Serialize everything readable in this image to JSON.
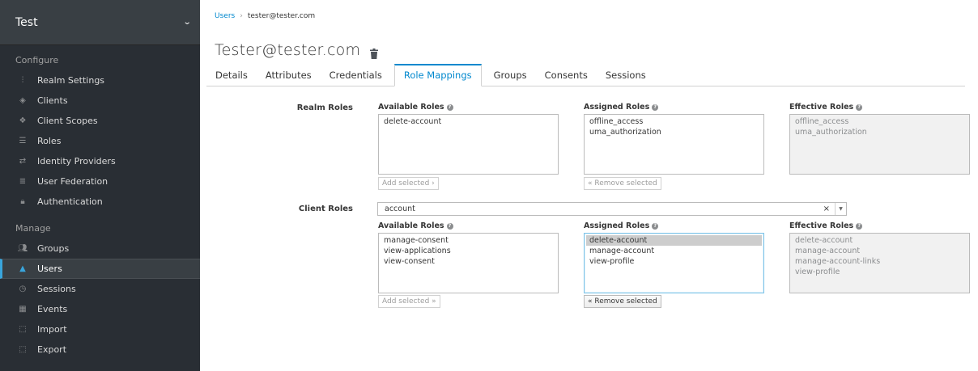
{
  "sidebar": {
    "realm": "Test",
    "configure_label": "Configure",
    "manage_label": "Manage",
    "configure_items": [
      {
        "label": "Realm Settings",
        "icon": "sliders-icon"
      },
      {
        "label": "Clients",
        "icon": "cube-icon"
      },
      {
        "label": "Client Scopes",
        "icon": "cubes-icon"
      },
      {
        "label": "Roles",
        "icon": "list-icon"
      },
      {
        "label": "Identity Providers",
        "icon": "exchange-icon"
      },
      {
        "label": "User Federation",
        "icon": "database-icon"
      },
      {
        "label": "Authentication",
        "icon": "lock-icon"
      }
    ],
    "manage_items": [
      {
        "label": "Groups",
        "icon": "users-icon"
      },
      {
        "label": "Users",
        "icon": "user-icon",
        "active": true
      },
      {
        "label": "Sessions",
        "icon": "clock-icon"
      },
      {
        "label": "Events",
        "icon": "calendar-icon"
      },
      {
        "label": "Import",
        "icon": "import-icon"
      },
      {
        "label": "Export",
        "icon": "export-icon"
      }
    ]
  },
  "breadcrumb": {
    "parent": "Users",
    "current": "tester@tester.com"
  },
  "title": "Tester@tester.com",
  "tabs": [
    "Details",
    "Attributes",
    "Credentials",
    "Role Mappings",
    "Groups",
    "Consents",
    "Sessions"
  ],
  "active_tab": "Role Mappings",
  "realm_roles": {
    "label": "Realm Roles",
    "available_label": "Available Roles",
    "assigned_label": "Assigned Roles",
    "effective_label": "Effective Roles",
    "available": [
      "delete-account"
    ],
    "assigned": [
      "offline_access",
      "uma_authorization"
    ],
    "effective": [
      "offline_access",
      "uma_authorization"
    ],
    "add_button": "Add selected ›",
    "remove_button": "« Remove selected"
  },
  "client_roles": {
    "label": "Client Roles",
    "selected_client": "account",
    "clear_glyph": "×",
    "available_label": "Available Roles",
    "assigned_label": "Assigned Roles",
    "effective_label": "Effective Roles",
    "available": [
      "manage-consent",
      "view-applications",
      "view-consent"
    ],
    "assigned": [
      "delete-account",
      "manage-account",
      "view-profile"
    ],
    "assigned_selected": "delete-account",
    "effective": [
      "delete-account",
      "manage-account",
      "manage-account-links",
      "view-profile"
    ],
    "add_button": "Add selected »",
    "remove_button": "« Remove selected"
  },
  "colors": {
    "sidebar_bg": "#292e34",
    "accent": "#0088ce",
    "active_bar": "#39a5dc"
  }
}
